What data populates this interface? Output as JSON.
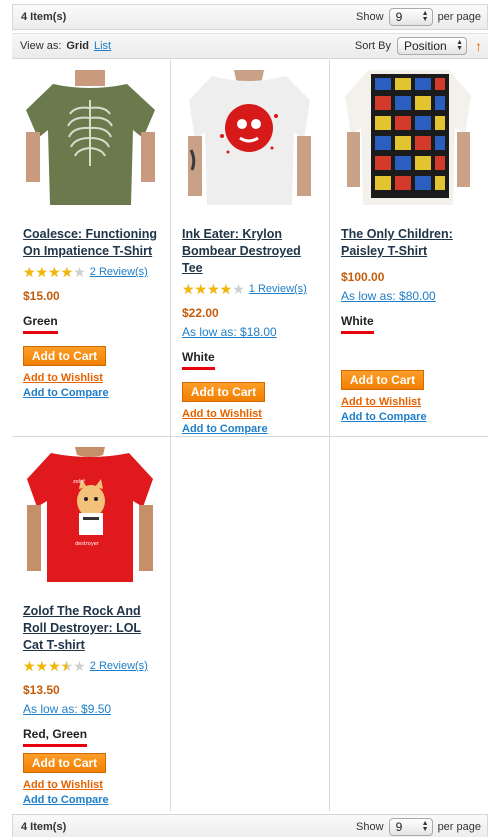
{
  "toolbar_top": {
    "amount": "4 Item(s)",
    "show_label": "Show",
    "limit": "9",
    "per_page": "per page"
  },
  "toolbar_bottom": {
    "amount": "4 Item(s)",
    "show_label": "Show",
    "limit": "9",
    "per_page": "per page"
  },
  "sorter": {
    "view_as": "View as:",
    "grid": "Grid",
    "list": "List",
    "sort_by": "Sort By",
    "sort_value": "Position",
    "direction_icon": "up-arrow-icon"
  },
  "colors": {
    "accent": "#f07f00",
    "link": "#1e7ec8",
    "price": "#c45c0b",
    "underline": "#e8000c"
  },
  "products": [
    {
      "name": "Coalesce: Functioning On Impatience T-Shirt",
      "rating": 0.8,
      "reviews": "2 Review(s)",
      "price": "$15.00",
      "low_price": "",
      "color": "Green",
      "add_to_cart": "Add to Cart",
      "wishlist": "Add to Wishlist",
      "compare": "Add to Compare"
    },
    {
      "name": "Ink Eater: Krylon Bombear Destroyed Tee",
      "rating": 0.8,
      "reviews": "1 Review(s)",
      "price": "$22.00",
      "low_price": "As low as: $18.00",
      "color": "White",
      "add_to_cart": "Add to Cart",
      "wishlist": "Add to Wishlist",
      "compare": "Add to Compare"
    },
    {
      "name": "The Only Children: Paisley T-Shirt",
      "rating": null,
      "reviews": "",
      "price": "$100.00",
      "low_price": "As low as: $80.00",
      "color": "White",
      "add_to_cart": "Add to Cart",
      "wishlist": "Add to Wishlist",
      "compare": "Add to Compare"
    },
    {
      "name": "Zolof The Rock And Roll Destroyer: LOL Cat T-shirt",
      "rating": 0.7,
      "reviews": "2 Review(s)",
      "price": "$13.50",
      "low_price": "As low as: $9.50",
      "color": "Red, Green",
      "add_to_cart": "Add to Cart",
      "wishlist": "Add to Wishlist",
      "compare": "Add to Compare"
    }
  ]
}
